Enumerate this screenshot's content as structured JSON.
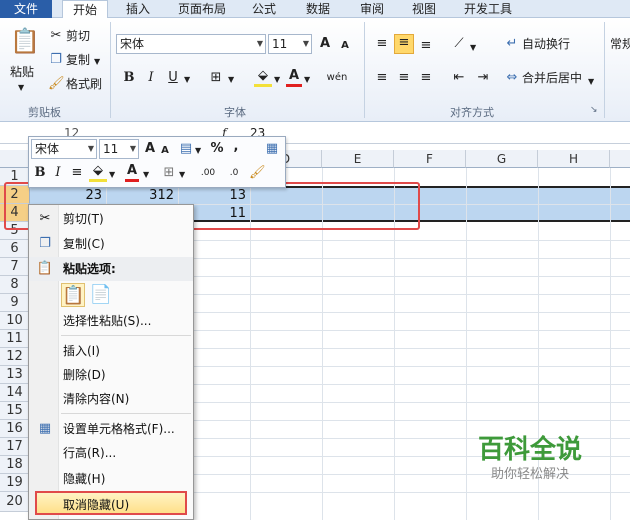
{
  "tabs": [
    "文件",
    "开始",
    "插入",
    "页面布局",
    "公式",
    "数据",
    "审阅",
    "视图",
    "开发工具"
  ],
  "clipboard": {
    "paste": "粘贴",
    "cut": "剪切",
    "copy": "复制",
    "format_painter": "格式刷",
    "group": "剪贴板"
  },
  "font": {
    "name": "宋体",
    "size": "11",
    "bold": "B",
    "italic": "I",
    "underline": "U",
    "group": "字体",
    "grow": "A",
    "shrink": "A",
    "phonetic": "wén",
    "font_color": "A"
  },
  "alignment": {
    "wrap": "自动换行",
    "merge": "合并后居中",
    "group": "对齐方式",
    "number_label": "常规"
  },
  "formula": {
    "name_value": "12",
    "fx": "f",
    "content": "23"
  },
  "columns": [
    "D",
    "E",
    "F",
    "G",
    "H"
  ],
  "rows": [
    "1",
    "2",
    "4",
    "5",
    "6",
    "7",
    "8",
    "9",
    "10",
    "11",
    "12",
    "13",
    "14",
    "15",
    "16",
    "17",
    "18",
    "19",
    "20"
  ],
  "cells": {
    "r2": [
      "23",
      "312",
      "13"
    ],
    "r4": [
      "11"
    ]
  },
  "mini_toolbar": {
    "font": "宋体",
    "size": "11",
    "percent": "%",
    "comma": ",",
    "bold": "B",
    "italic": "I",
    "font_color": "A",
    "inc_dec": ".00",
    "dec_dec": ".0"
  },
  "context_menu": [
    {
      "label": "剪切(T)",
      "icon": "scissors-icon"
    },
    {
      "label": "复制(C)",
      "icon": "copy-icon"
    },
    {
      "label": "粘贴选项:",
      "icon": "paste-icon"
    },
    {
      "label": "选择性粘贴(S)...",
      "icon": ""
    },
    {
      "label": "插入(I)",
      "icon": ""
    },
    {
      "label": "删除(D)",
      "icon": ""
    },
    {
      "label": "清除内容(N)",
      "icon": ""
    },
    {
      "label": "设置单元格格式(F)...",
      "icon": "format-cells-icon"
    },
    {
      "label": "行高(R)...",
      "icon": ""
    },
    {
      "label": "隐藏(H)",
      "icon": ""
    },
    {
      "label": "取消隐藏(U)",
      "icon": ""
    }
  ],
  "watermark": {
    "title": "百科全说",
    "subtitle": "助你轻松解决"
  }
}
